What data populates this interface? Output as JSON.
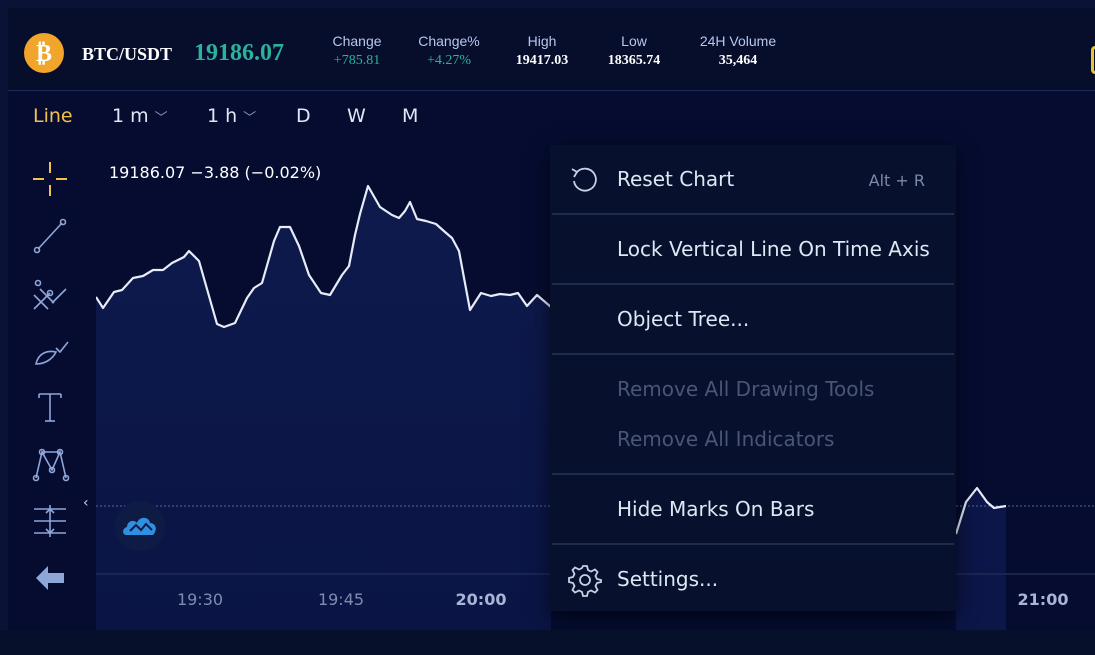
{
  "ticker": {
    "coin_symbol": "₿",
    "pair": "BTC/USDT",
    "last_price": "19186.07",
    "stats": {
      "change_label": "Change",
      "change_value": "+785.81",
      "change_pct_label": "Change%",
      "change_pct_value": "+4.27%",
      "high_label": "High",
      "high_value": "19417.03",
      "low_label": "Low",
      "low_value": "18365.74",
      "volume_label": "24H Volume",
      "volume_value": "35,464"
    }
  },
  "timeframes": {
    "line": "Line",
    "minute": "1 m",
    "hour": "1 h",
    "day": "D",
    "week": "W",
    "month": "M",
    "chevron": "﹀"
  },
  "chart": {
    "readout": "19186.07 −3.88 (−0.02%)",
    "collapse_arrow": "‹",
    "time_ticks": [
      "19:30",
      "19:45",
      "20:00",
      "21:00"
    ]
  },
  "context_menu": {
    "reset_chart": "Reset Chart",
    "reset_shortcut": "Alt + R",
    "lock_vertical": "Lock Vertical Line On Time Axis",
    "object_tree": "Object Tree...",
    "remove_drawing": "Remove All Drawing Tools",
    "remove_indicators": "Remove All Indicators",
    "hide_marks": "Hide Marks On Bars",
    "settings": "Settings..."
  },
  "icons": {
    "crosshair": "crosshair-icon",
    "trend_line": "trend-line-icon",
    "fib": "fibonacci-icon",
    "brush": "brush-icon",
    "text": "text-icon",
    "pattern": "pattern-icon",
    "measure": "measure-icon",
    "back": "back-arrow-icon",
    "coin": "bitcoin-icon",
    "cloud": "cloud-icon",
    "reset": "reset-icon",
    "settings": "gear-icon"
  },
  "colors": {
    "background": "#0a1235",
    "panel": "#050c30",
    "accent_gold": "#f2c14c",
    "positive": "#2ab39a",
    "line": "#e6ecf8",
    "tool_icon": "#8fa6d8",
    "menu_bg": "#07102d",
    "coin": "#f1a52a"
  }
}
